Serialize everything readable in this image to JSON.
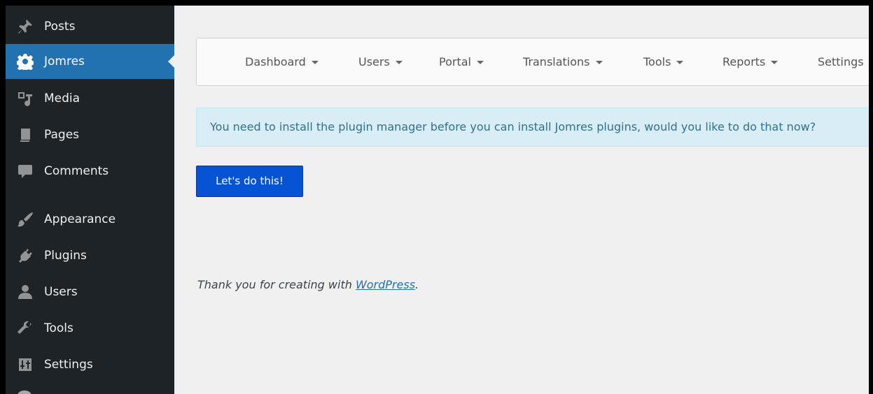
{
  "sidebar": {
    "items": [
      {
        "label": "Posts",
        "icon": "pushpin-icon"
      },
      {
        "label": "Jomres",
        "icon": "gear-icon",
        "active": true
      },
      {
        "label": "Media",
        "icon": "media-icon"
      },
      {
        "label": "Pages",
        "icon": "pages-icon"
      },
      {
        "label": "Comments",
        "icon": "comment-bubble-icon"
      },
      {
        "label": "Appearance",
        "icon": "paintbrush-icon"
      },
      {
        "label": "Plugins",
        "icon": "plug-icon"
      },
      {
        "label": "Users",
        "icon": "user-icon"
      },
      {
        "label": "Tools",
        "icon": "wrench-icon"
      },
      {
        "label": "Settings",
        "icon": "sliders-icon"
      }
    ]
  },
  "topnav": {
    "items": [
      {
        "label": "Dashboard"
      },
      {
        "label": "Users"
      },
      {
        "label": "Portal"
      },
      {
        "label": "Translations"
      },
      {
        "label": "Tools"
      },
      {
        "label": "Reports"
      },
      {
        "label": "Settings"
      }
    ]
  },
  "alert": {
    "message": "You need to install the plugin manager before you can install Jomres plugins, would you like to do that now?"
  },
  "action": {
    "button_label": "Let's do this!"
  },
  "footer": {
    "prefix": "Thank you for creating with ",
    "link": "WordPress",
    "suffix": "."
  },
  "colors": {
    "sidebar_bg": "#1d2327",
    "active_bg": "#2271b1",
    "content_bg": "#f0f0f1",
    "alert_bg": "#d9edf7",
    "alert_text": "#31708f",
    "button_bg": "#0654d3"
  }
}
